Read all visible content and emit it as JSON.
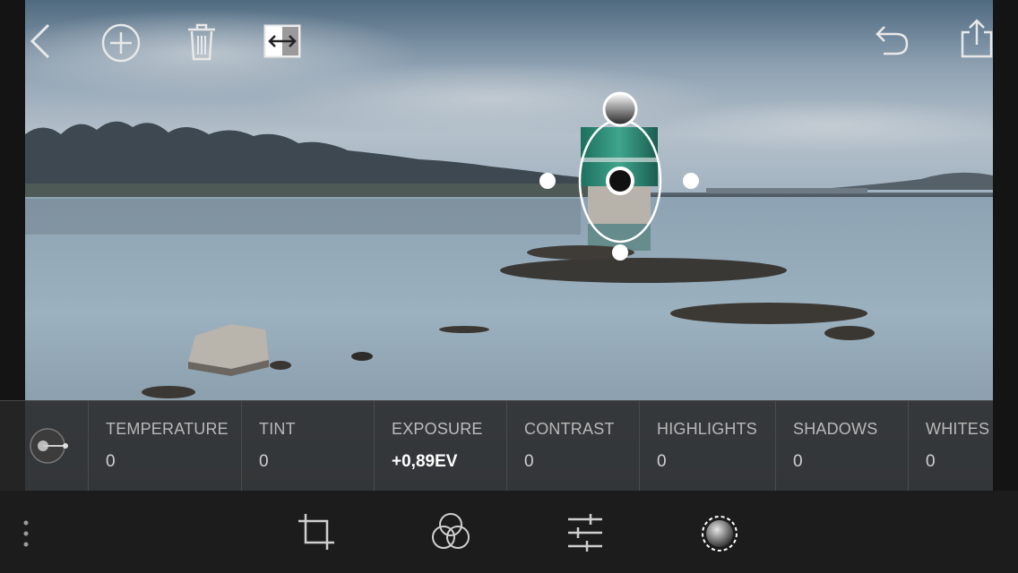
{
  "colors": {
    "accent": "#ffffff",
    "panel_bg": "#282828",
    "toolbar_bg": "#1c1c1c",
    "label": "#b8b8b8"
  },
  "top_bar": {
    "back_icon": "chevron-left-icon",
    "add_icon": "plus-circle-icon",
    "delete_icon": "trash-icon",
    "compare_icon": "before-after-icon",
    "undo_icon": "undo-icon",
    "share_icon": "share-icon"
  },
  "params": [
    {
      "label": "TEMPERATURE",
      "value": "0"
    },
    {
      "label": "TINT",
      "value": "0"
    },
    {
      "label": "EXPOSURE",
      "value": "+0,89EV",
      "active": true
    },
    {
      "label": "CONTRAST",
      "value": "0"
    },
    {
      "label": "HIGHLIGHTS",
      "value": "0"
    },
    {
      "label": "SHADOWS",
      "value": "0"
    },
    {
      "label": "WHITES",
      "value": "0"
    }
  ],
  "toolbar": {
    "more_icon": "more-vertical-icon",
    "tools": [
      "crop-icon",
      "color-mix-icon",
      "sliders-icon",
      "radial-filter-icon"
    ],
    "active_tool": "radial-filter-icon"
  }
}
